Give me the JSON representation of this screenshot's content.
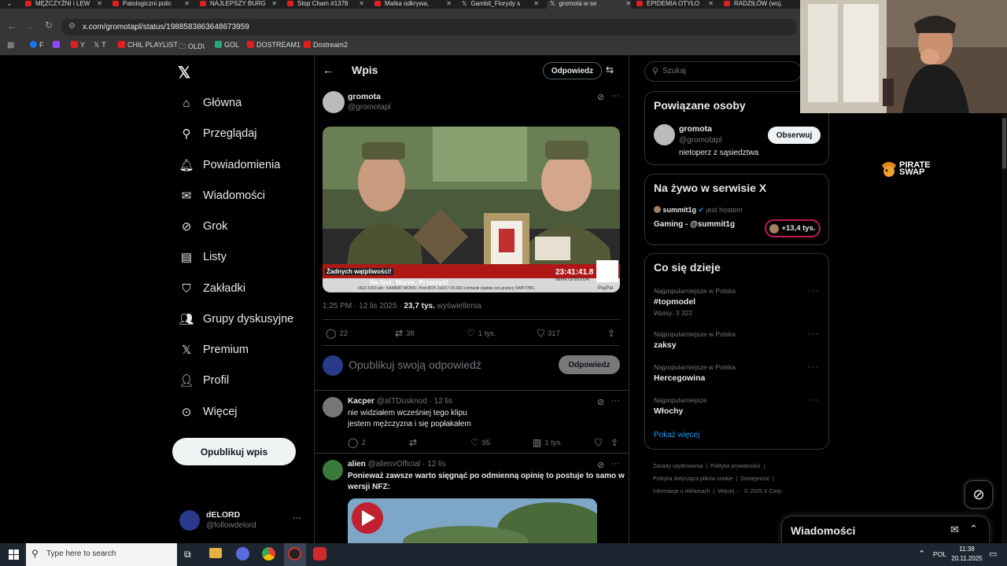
{
  "browser": {
    "tabs": [
      {
        "title": "MĘŻCZYŹNI i LEW"
      },
      {
        "title": "Patologiczni polic"
      },
      {
        "title": "NAJLEPSZY BURG"
      },
      {
        "title": "Stop Cham #1378"
      },
      {
        "title": "Matka odkrywa, "
      },
      {
        "title": "Gambit_Florydy s"
      },
      {
        "title": "gromota w se"
      },
      {
        "title": "EPIDEMIA OTYŁO"
      },
      {
        "title": "RADZIŁÓW (woj."
      }
    ],
    "url": "x.com/gromotapl/status/1988583863648673959",
    "bookmarks": [
      {
        "label": "F"
      },
      {
        "label": ""
      },
      {
        "label": "Y"
      },
      {
        "label": "T"
      },
      {
        "label": "CHIL PLAYLIST"
      },
      {
        "label": "OLD\\"
      },
      {
        "label": "GOL"
      },
      {
        "label": "DOSTREAM1"
      },
      {
        "label": "Dostream2"
      }
    ]
  },
  "nav": {
    "items": [
      {
        "label": "Główna",
        "icon": "home-icon"
      },
      {
        "label": "Przeglądaj",
        "icon": "search-icon"
      },
      {
        "label": "Powiadomienia",
        "icon": "bell-icon"
      },
      {
        "label": "Wiadomości",
        "icon": "mail-icon"
      },
      {
        "label": "Grok",
        "icon": "grok-icon"
      },
      {
        "label": "Listy",
        "icon": "list-icon"
      },
      {
        "label": "Zakładki",
        "icon": "bookmark-icon"
      },
      {
        "label": "Grupy dyskusyjne",
        "icon": "people-icon"
      },
      {
        "label": "Premium",
        "icon": "x-logo-icon"
      },
      {
        "label": "Profil",
        "icon": "person-icon"
      },
      {
        "label": "Więcej",
        "icon": "more-circle-icon"
      }
    ],
    "post_button": "Opublikuj wpis",
    "account": {
      "name": "dELORD",
      "handle": "@followdelord"
    }
  },
  "main": {
    "header_title": "Wpis",
    "reply_button": "Odpowiedz",
    "post": {
      "author": "gromota",
      "handle": "@gromotapl",
      "video": {
        "caption_top": "Żadnych wątpliwości!",
        "ticker_on_line": "Na linii: Marek, Przemyśl",
        "time": "23:41:41.8",
        "date": "wtorek 03-09-2024r.",
        "ticker_bottom": "0623 6303 adr.: KAMRAT MOWO. Post.BOX 216/17 05-092 Łomianki (wpłaty zza granicy SWIFT/BIC",
        "badge": "PayPal"
      },
      "time": "1:25 PM",
      "date": "12 lis 2025",
      "views": "23,7 tys.",
      "views_label": "wyświetlenia",
      "stats": {
        "replies": "22",
        "reposts": "38",
        "likes": "1 tys.",
        "bookmarks": "317"
      }
    },
    "compose": {
      "placeholder": "Opublikuj swoją odpowiedź",
      "button": "Odpowiedz"
    },
    "replies": [
      {
        "author": "Kacper",
        "handle": "@aITDusknod",
        "time": "12 lis",
        "text1": "nie widziałem wcześniej tego klipu",
        "text2": "jestem mężczyzna i się popłakałem",
        "stats": {
          "replies": "2",
          "likes": "95",
          "views": "1 tys."
        }
      },
      {
        "author": "alien",
        "handle": "@alienvOfficial",
        "time": "12 lis",
        "text1": "Ponieważ zawsze warto sięgnąć po odmienną opinię to postuje to samo w",
        "text2": "wersji NFZ:"
      }
    ]
  },
  "right": {
    "search_placeholder": "Szukaj",
    "related": {
      "title": "Powiązane osoby",
      "name": "gromota",
      "handle": "@gromotapl",
      "bio": "nietoperz z sąsiedztwa",
      "follow": "Obserwuj"
    },
    "live": {
      "title": "Na żywo w serwisie X",
      "host": "summit1g",
      "host_suffix": "jest hostem",
      "stream": "Gaming - @summit1g",
      "viewers": "+13,4 tys."
    },
    "trends": {
      "title": "Co się dzieje",
      "items": [
        {
          "category": "Najpopularniejsze w Polska",
          "name": "#topmodel",
          "meta": "Wpisy: 3 322"
        },
        {
          "category": "Najpopularniejsze w Polska",
          "name": "zaksy",
          "meta": ""
        },
        {
          "category": "Najpopularniejsze w Polska",
          "name": "Hercegowina",
          "meta": ""
        },
        {
          "category": "Najpopularniejsze",
          "name": "Włochy",
          "meta": ""
        }
      ],
      "show_more": "Pokaż więcej"
    },
    "footer": {
      "line1a": "Zasady użytkowania",
      "line1b": "Polityka prywatności",
      "line2a": "Polityka dotycząca plików cookie",
      "line2b": "Dostępność",
      "line3a": "Informacje o reklamach",
      "line3b": "Więcej ···",
      "line3c": "© 2025 X Corp."
    },
    "messages_drawer": "Wiadomości"
  },
  "overlay": {
    "sponsor_line1": "PIRATE",
    "sponsor_line2": "SWAP"
  },
  "taskbar": {
    "search_placeholder": "Type here to search",
    "lang": "POL",
    "time": "11:38",
    "date": "20.11.2025"
  },
  "colors": {
    "accent": "#1d9bf0",
    "background": "#000000",
    "border": "#2f3336",
    "muted": "#71767b"
  }
}
